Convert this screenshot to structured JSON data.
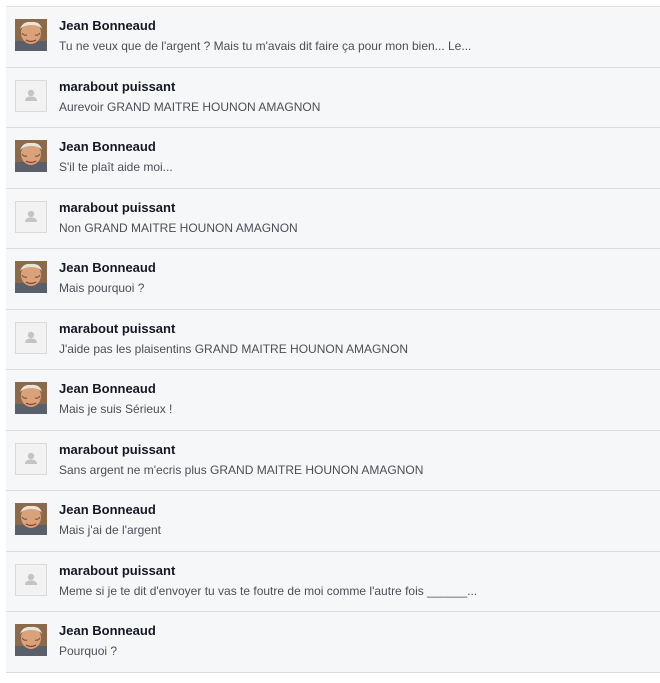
{
  "messages": [
    {
      "sender": "Jean Bonneaud",
      "avatar": "photo",
      "text": "Tu ne veux que de l'argent ? Mais tu m'avais dit faire ça pour mon bien... Le..."
    },
    {
      "sender": "marabout puissant",
      "avatar": "default",
      "text": "Aurevoir GRAND MAITRE HOUNON AMAGNON"
    },
    {
      "sender": "Jean Bonneaud",
      "avatar": "photo",
      "text": "S'il te plaît aide moi..."
    },
    {
      "sender": "marabout puissant",
      "avatar": "default",
      "text": "Non GRAND MAITRE HOUNON AMAGNON"
    },
    {
      "sender": "Jean Bonneaud",
      "avatar": "photo",
      "text": "Mais pourquoi ?"
    },
    {
      "sender": "marabout puissant",
      "avatar": "default",
      "text": "J'aide pas les plaisentins GRAND MAITRE HOUNON AMAGNON"
    },
    {
      "sender": "Jean Bonneaud",
      "avatar": "photo",
      "text": "Mais je suis Sérieux !"
    },
    {
      "sender": "marabout puissant",
      "avatar": "default",
      "text": "Sans argent ne m'ecris plus GRAND MAITRE HOUNON AMAGNON"
    },
    {
      "sender": "Jean Bonneaud",
      "avatar": "photo",
      "text": "Mais j'ai de l'argent"
    },
    {
      "sender": "marabout puissant",
      "avatar": "default",
      "text": "Meme si je te dit d'envoyer tu vas te foutre de moi comme l'autre fois ______..."
    },
    {
      "sender": "Jean Bonneaud",
      "avatar": "photo",
      "text": "Pourquoi ?"
    }
  ],
  "colors": {
    "row_background": "#f6f7f8",
    "separator": "#dcdcdc",
    "sender_text": "#141823",
    "message_text": "#4b4f56"
  }
}
